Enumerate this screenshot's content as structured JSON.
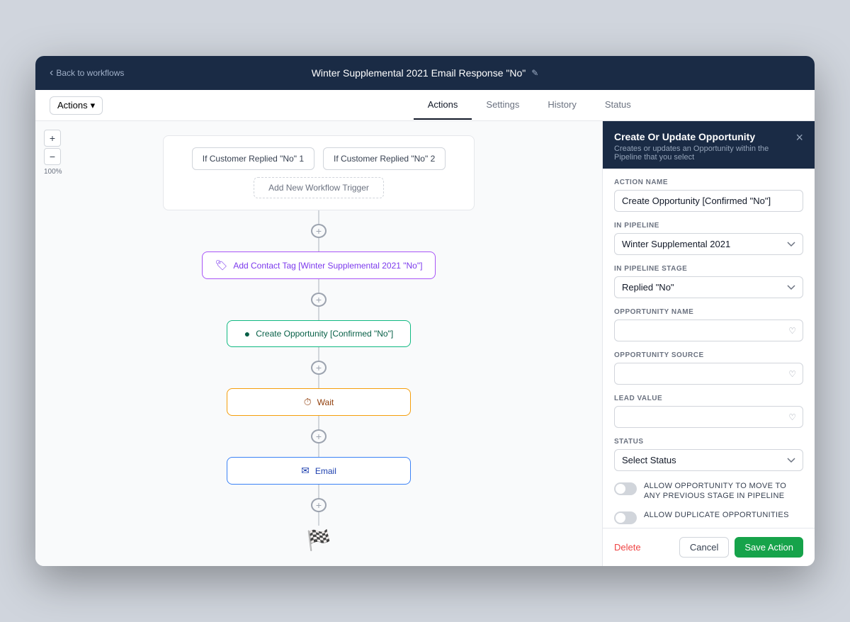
{
  "topbar": {
    "back_label": "Back to workflows",
    "title": "Winter Supplemental 2021 Email Response \"No\"",
    "edit_icon": "✎"
  },
  "tabs": {
    "actions_dropdown": "Actions",
    "items": [
      {
        "label": "Actions",
        "active": true
      },
      {
        "label": "Settings",
        "active": false
      },
      {
        "label": "History",
        "active": false
      },
      {
        "label": "Status",
        "active": false
      }
    ]
  },
  "zoom": {
    "plus": "+",
    "minus": "−",
    "level": "100%"
  },
  "workflow": {
    "trigger1": "If Customer Replied \"No\" 1",
    "trigger2": "If Customer Replied \"No\" 2",
    "add_trigger": "Add New Workflow Trigger",
    "nodes": [
      {
        "id": "tag",
        "label": "Add Contact Tag [Winter Supplemental 2021 \"No\"]",
        "type": "tag"
      },
      {
        "id": "opportunity",
        "label": "Create Opportunity [Confirmed \"No\"]",
        "type": "opportunity"
      },
      {
        "id": "wait",
        "label": "Wait",
        "type": "wait"
      },
      {
        "id": "email",
        "label": "Email",
        "type": "email"
      }
    ]
  },
  "panel": {
    "title": "Create Or Update Opportunity",
    "subtitle": "Creates or updates an Opportunity within the Pipeline that you select",
    "close_icon": "×",
    "fields": {
      "action_name_label": "ACTION NAME",
      "action_name_value": "Create Opportunity [Confirmed \"No\"]",
      "in_pipeline_label": "IN PIPELINE",
      "in_pipeline_value": "Winter Supplemental 2021",
      "in_pipeline_stage_label": "IN PIPELINE STAGE",
      "in_pipeline_stage_value": "Replied \"No\"",
      "opportunity_name_label": "OPPORTUNITY NAME",
      "opportunity_name_value": "",
      "opportunity_source_label": "OPPORTUNITY SOURCE",
      "opportunity_source_value": "",
      "lead_value_label": "LEAD VALUE",
      "lead_value_value": "",
      "status_label": "STATUS",
      "status_value": "Select Status"
    },
    "toggles": [
      {
        "label": "ALLOW OPPORTUNITY TO MOVE TO ANY PREVIOUS STAGE IN PIPELINE"
      },
      {
        "label": "ALLOW DUPLICATE OPPORTUNITIES"
      }
    ],
    "footer": {
      "delete_label": "Delete",
      "cancel_label": "Cancel",
      "save_label": "Save Action"
    }
  }
}
